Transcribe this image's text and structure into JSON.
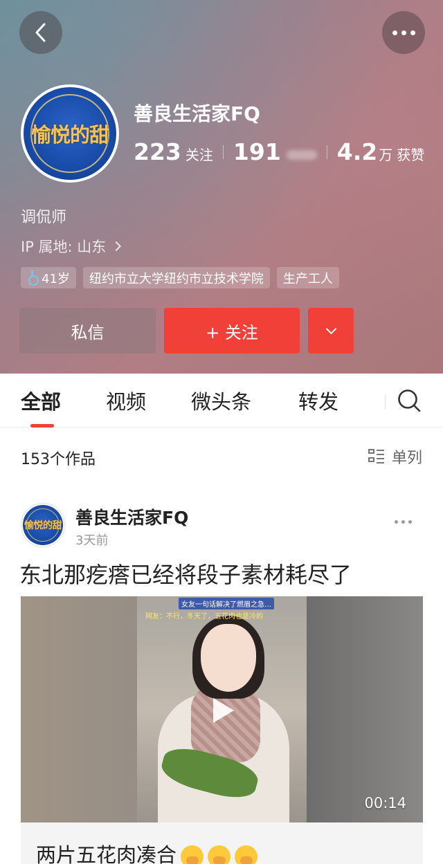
{
  "profile": {
    "avatar_text": "愉悦的甜",
    "name": "善良生活家FQ",
    "following_count": "223",
    "following_label": "关注",
    "followers_count": "191",
    "likes_count": "4.2",
    "likes_unit": "万",
    "likes_label": "获赞",
    "bio": "调侃师",
    "ip_location": "IP 属地: 山东",
    "tags": [
      "41岁",
      "纽约市立大学纽约市立技术学院",
      "生产工人"
    ]
  },
  "actions": {
    "message_label": "私信",
    "follow_label": "+ 关注"
  },
  "tabs": [
    {
      "label": "全部",
      "active": true
    },
    {
      "label": "视频",
      "active": false
    },
    {
      "label": "微头条",
      "active": false
    },
    {
      "label": "转发",
      "active": false
    }
  ],
  "list_header": {
    "count_text": "153个作品",
    "view_mode_label": "单列"
  },
  "post": {
    "author": "善良生活家FQ",
    "time": "3天前",
    "title": "东北那疙瘩已经将段子素材耗尽了",
    "video_overlay_line1": "女友一句话解决了燃眉之急…",
    "video_overlay_line2": "网友：不行，冬天了，五花肉也是冷的",
    "duration": "00:14",
    "caption": "两片五花肉凑合"
  },
  "colors": {
    "accent_red": "#f04038",
    "gender_icon": "#7ec3f0"
  },
  "icons": [
    "back-arrow-icon",
    "more-dots-icon",
    "female-icon",
    "chevron-down-icon",
    "search-icon",
    "list-view-icon",
    "play-icon"
  ]
}
